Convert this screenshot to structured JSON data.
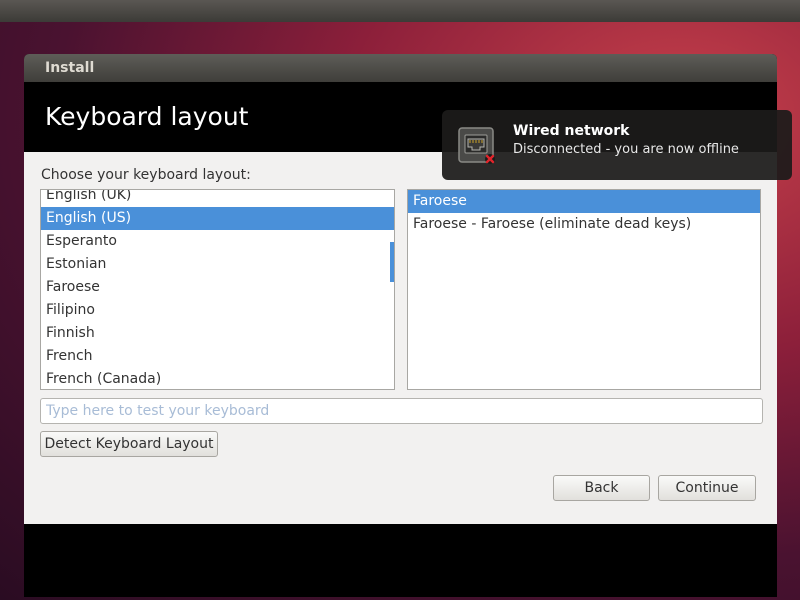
{
  "window": {
    "title": "Install"
  },
  "page": {
    "title": "Keyboard layout"
  },
  "content": {
    "prompt": "Choose your keyboard layout:",
    "layouts": [
      {
        "label": "English (UK)",
        "selected": false
      },
      {
        "label": "English (US)",
        "selected": true
      },
      {
        "label": "Esperanto",
        "selected": false
      },
      {
        "label": "Estonian",
        "selected": false
      },
      {
        "label": "Faroese",
        "selected": false
      },
      {
        "label": "Filipino",
        "selected": false
      },
      {
        "label": "Finnish",
        "selected": false
      },
      {
        "label": "French",
        "selected": false
      },
      {
        "label": "French (Canada)",
        "selected": false
      }
    ],
    "variants": [
      {
        "label": "Faroese",
        "selected": true
      },
      {
        "label": "Faroese - Faroese (eliminate dead keys)",
        "selected": false
      }
    ],
    "test_input": {
      "value": "",
      "placeholder": "Type here to test your keyboard"
    },
    "detect_button": "Detect Keyboard Layout",
    "back_button": "Back",
    "continue_button": "Continue"
  },
  "notification": {
    "title": "Wired network",
    "body": "Disconnected - you are now offline",
    "icon": "network-wired-disconnected-icon"
  },
  "colors": {
    "selection": "#4a90d9",
    "disconnect_badge": "#e0242b"
  }
}
